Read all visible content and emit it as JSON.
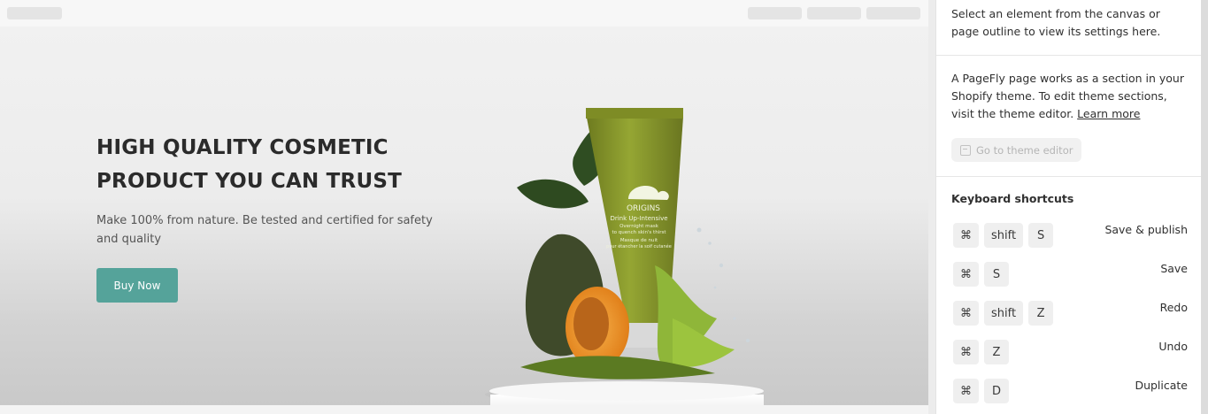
{
  "canvas": {
    "hero": {
      "headline_line1": "HIGH QUALITY COSMETIC",
      "headline_line2": "PRODUCT YOU CAN TRUST",
      "subtext": "Make 100% from nature. Be tested and certified for safety and quality",
      "button_label": "Buy Now",
      "accent_color": "#55a39a"
    },
    "product_image": {
      "brand": "ORIGINS",
      "name": "Drink Up-Intensive",
      "line2": "Overnight mask",
      "line3": "to quench skin's thirst",
      "line4": "Masque de nuit",
      "line5": "pour étancher la soif cutanée"
    }
  },
  "panel": {
    "hint": "Select an element from the canvas or page outline to view its settings here.",
    "info_text": "A PageFly page works as a section in your Shopify theme. To edit theme sections, visit the theme editor.",
    "learn_more": "Learn more",
    "theme_editor_button": "Go to theme editor",
    "shortcuts_title": "Keyboard shortcuts",
    "shortcuts": [
      {
        "keys": [
          "⌘",
          "shift",
          "S"
        ],
        "label": "Save & publish"
      },
      {
        "keys": [
          "⌘",
          "S"
        ],
        "label": "Save"
      },
      {
        "keys": [
          "⌘",
          "shift",
          "Z"
        ],
        "label": "Redo"
      },
      {
        "keys": [
          "⌘",
          "Z"
        ],
        "label": "Undo"
      },
      {
        "keys": [
          "⌘",
          "D"
        ],
        "label": "Duplicate"
      }
    ]
  }
}
